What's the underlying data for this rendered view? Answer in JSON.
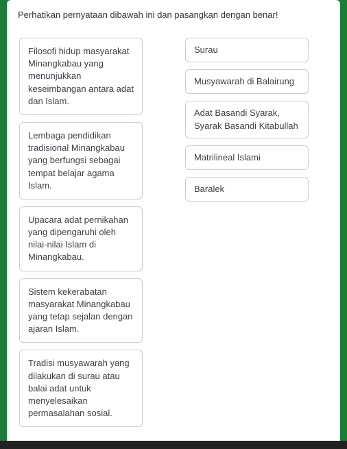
{
  "instruction": "Perhatikan pernyataan dibawah ini dan pasangkan dengan benar!",
  "left": [
    {
      "text": "Filosofi hidup masyarakat Minangkabau yang menunjukkan keseimbangan antara adat dan Islam."
    },
    {
      "text": "Lembaga pendidikan tradisional Minangkabau yang berfungsi sebagai tempat belajar agama Islam."
    },
    {
      "text": "Upacara adat pernikahan yang dipengaruhi oleh nilai-nilai Islam di Minangkabau."
    },
    {
      "text": "Sistem kekerabatan masyarakat Minangkabau yang tetap sejalan dengan ajaran Islam."
    },
    {
      "text": "Tradisi musyawarah yang dilakukan di surau atau balai adat untuk menyelesaikan permasalahan sosial."
    }
  ],
  "right": [
    {
      "text": "Surau"
    },
    {
      "text": "Musyawarah di Balairung"
    },
    {
      "text": "Adat Basandi Syarak, Syarak Basandi Kitabullah"
    },
    {
      "text": "Matrilineal Islami"
    },
    {
      "text": "Baralek"
    }
  ]
}
